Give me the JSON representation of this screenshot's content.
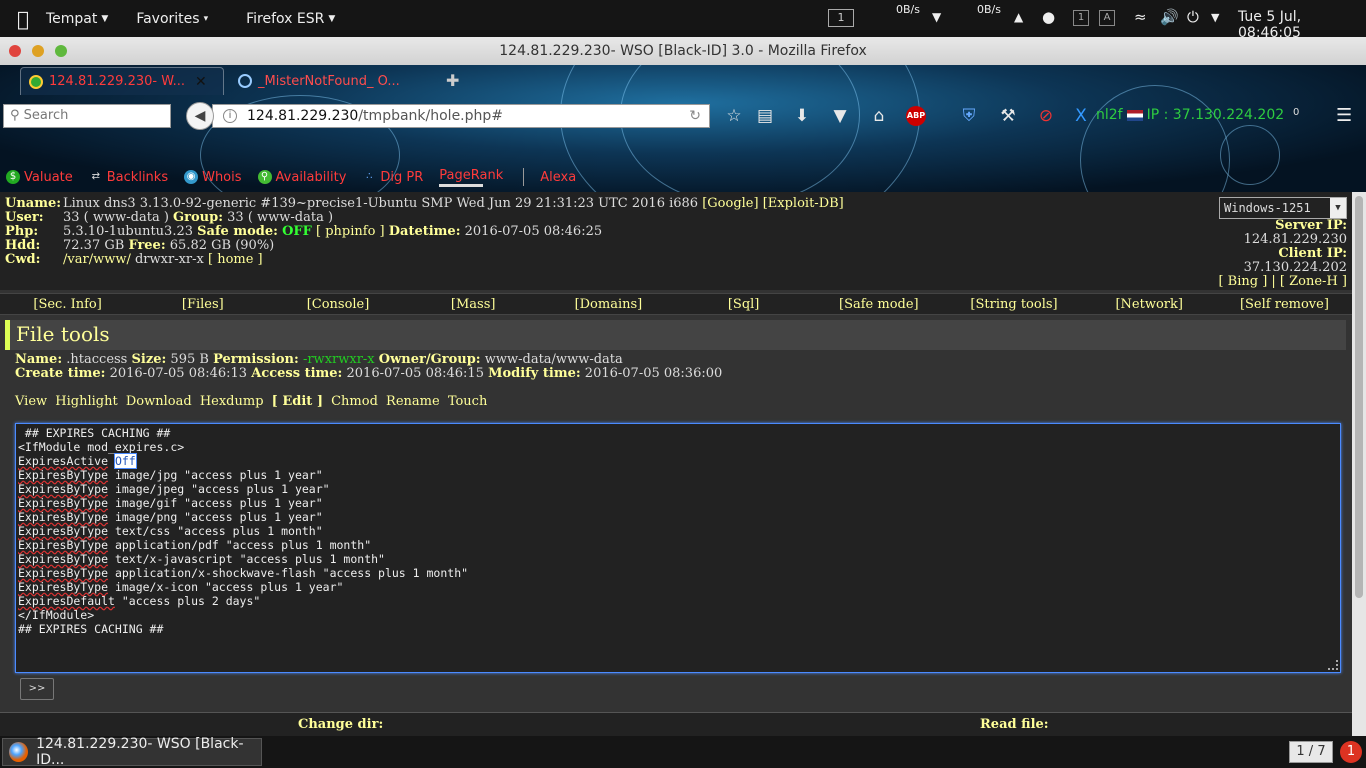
{
  "topbar": {
    "menus": [
      "Tempat",
      "Favorites",
      "Firefox ESR"
    ],
    "workspace": "1",
    "net_down": "0B/s",
    "net_up": "0B/s",
    "tray_boxes": [
      "1",
      "A"
    ],
    "clock": "Tue  5 Jul, 08:46:05"
  },
  "window": {
    "title": "124.81.229.230- WSO [Black-ID] 3.0 - Mozilla Firefox"
  },
  "tabs": [
    {
      "label": "124.81.229.230- W...",
      "active": true
    },
    {
      "label": "_MisterNotFound_ O...",
      "active": false
    }
  ],
  "toolbar": {
    "search_placeholder": "Search",
    "url_host": "124.81.229.230",
    "url_path": "/tmpbank/hole.php#",
    "abp": "ABP",
    "user": "nl2f",
    "ip_label": "IP : 37.130.224.202",
    "ip_count": "0"
  },
  "bookmarks": [
    "Valuate",
    "Backlinks",
    "Whois",
    "Availability",
    "Dig PR",
    "PageRank",
    "Alexa"
  ],
  "wso": {
    "uname_label": "Uname:",
    "uname": "Linux dns3 3.13.0-92-generic #139~precise1-Ubuntu SMP Wed Jun 29 21:31:23 UTC 2016 i686",
    "google": "[Google]",
    "exploitdb": "[Exploit-DB]",
    "user_label": "User:",
    "user": "33 ( www-data )",
    "group_label": "Group:",
    "group": "33 ( www-data )",
    "php_label": "Php:",
    "php": "5.3.10-1ubuntu3.23",
    "safe_label": "Safe mode:",
    "safe": "OFF",
    "phpinfo": "[ phpinfo ]",
    "datetime_label": "Datetime:",
    "datetime": "2016-07-05 08:46:25",
    "hdd_label": "Hdd:",
    "hdd": "72.37 GB",
    "free_label": "Free:",
    "free": "65.82 GB (90%)",
    "cwd_label": "Cwd:",
    "cwd_path": "/var/www/",
    "cwd_perm": "drwxr-xr-x",
    "home": "[ home ]",
    "charset": "Windows-1251",
    "server_ip_label": "Server IP:",
    "server_ip": "124.81.229.230",
    "client_ip_label": "Client IP:",
    "client_ip": "37.130.224.202",
    "bing_zone": "[ Bing ] | [ Zone-H ]"
  },
  "nav": [
    "[Sec. Info]",
    "[Files]",
    "[Console]",
    "[Mass]",
    "[Domains]",
    "[Sql]",
    "[Safe mode]",
    "[String tools]",
    "[Network]",
    "[Self remove]"
  ],
  "file": {
    "title": "File tools",
    "name_label": "Name:",
    "name": ".htaccess",
    "size_label": "Size:",
    "size": "595 B",
    "perm_label": "Permission:",
    "perm": "-rwxrwxr-x",
    "owner_label": "Owner/Group:",
    "owner": "www-data/www-data",
    "create_label": "Create time:",
    "create": "2016-07-05 08:46:13",
    "access_label": "Access time:",
    "access": "2016-07-05 08:46:15",
    "modify_label": "Modify time:",
    "modify": "2016-07-05 08:36:00",
    "actions": [
      "View",
      "Highlight",
      "Download",
      "Hexdump",
      "[ Edit ]",
      "Chmod",
      "Rename",
      "Touch"
    ]
  },
  "editor": {
    "lines": [
      " ## EXPIRES CACHING ##",
      "<IfModule mod_expires.c>",
      "ExpiresActive Off",
      "ExpiresByType image/jpg \"access plus 1 year\"",
      "ExpiresByType image/jpeg \"access plus 1 year\"",
      "ExpiresByType image/gif \"access plus 1 year\"",
      "ExpiresByType image/png \"access plus 1 year\"",
      "ExpiresByType text/css \"access plus 1 month\"",
      "ExpiresByType application/pdf \"access plus 1 month\"",
      "ExpiresByType text/x-javascript \"access plus 1 month\"",
      "ExpiresByType application/x-shockwave-flash \"access plus 1 month\"",
      "ExpiresByType image/x-icon \"access plus 1 year\"",
      "ExpiresDefault \"access plus 2 days\"",
      "</IfModule>",
      "## EXPIRES CACHING ##"
    ],
    "selected_word": "Off",
    "submit": ">>"
  },
  "bottom": {
    "change_dir": "Change dir:",
    "read_file": "Read file:"
  },
  "taskbar": {
    "item": "124.81.229.230- WSO [Black-ID...",
    "pager": "1 / 7",
    "notifications": "1"
  }
}
